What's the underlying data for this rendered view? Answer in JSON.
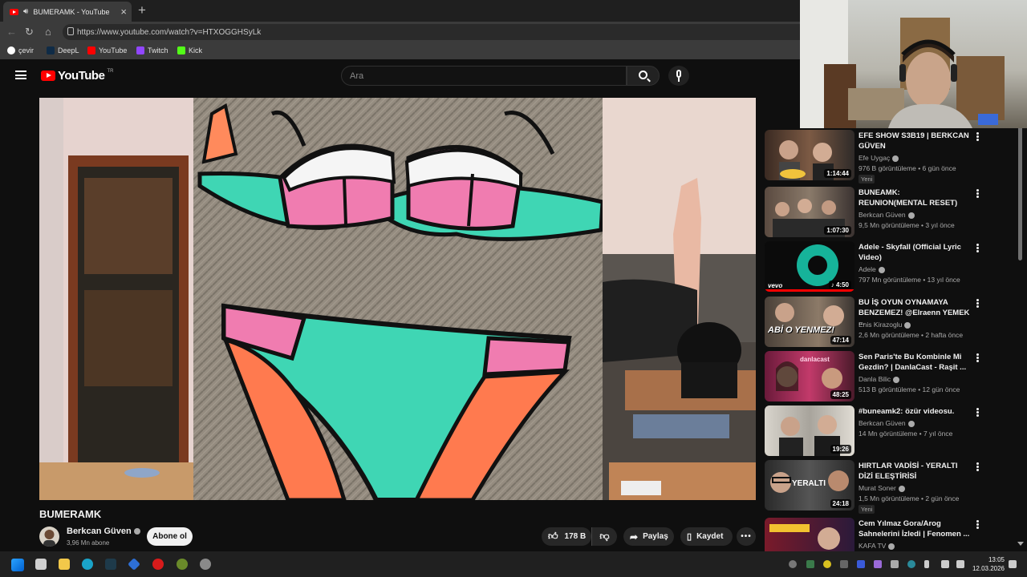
{
  "browser": {
    "tab_title": "BUMERAMK - YouTube",
    "url": "https://www.youtube.com/watch?v=HTXOGGHSyLk",
    "bookmarks": [
      "çevir",
      "DeepL",
      "YouTube",
      "Twitch",
      "Kick"
    ]
  },
  "header": {
    "logo_text": "YouTube",
    "region": "TR",
    "search_placeholder": "Ara"
  },
  "video": {
    "title": "BUMERAMK",
    "channel": "Berkcan Güven",
    "subscribers": "3,96 Mn abone",
    "subscribe_label": "Abone ol",
    "likes": "178 B",
    "share_label": "Paylaş",
    "save_label": "Kaydet"
  },
  "recommendations": [
    {
      "title": "EFE SHOW S3B19 | BERKCAN GÜVEN",
      "channel": "Efe Uygaç",
      "views": "976 B görüntüleme",
      "age": "6 gün önce",
      "duration": "1:14:44",
      "new": "Yeni"
    },
    {
      "title": "BUNEAMK: REUNION(MENTAL RESET)",
      "channel": "Berkcan Güven",
      "views": "9,5 Mn görüntüleme",
      "age": "3 yıl önce",
      "duration": "1:07:30"
    },
    {
      "title": "Adele - Skyfall (Official Lyric Video)",
      "channel": "Adele",
      "views": "797 Mn görüntüleme",
      "age": "13 yıl önce",
      "duration": "4:50",
      "badge": "vevo"
    },
    {
      "title": "BU İŞ OYUN OYNAMAYA BENZEMEZ! @Elraenn YEMEK ...",
      "channel": "Enis Kirazoglu",
      "views": "2,6 Mn görüntüleme",
      "age": "2 hafta önce",
      "duration": "47:14",
      "thumb_text": "ABİ O YENMEZ!"
    },
    {
      "title": "Sen Paris'te Bu Kombinle Mi Gezdin? | DanlaCast - Raşit ...",
      "channel": "Danla Bilic",
      "views": "513 B görüntüleme",
      "age": "12 gün önce",
      "duration": "48:25",
      "thumb_text": "danlacast"
    },
    {
      "title": "#buneamk2: özür videosu.",
      "channel": "Berkcan Güven",
      "views": "14 Mn görüntüleme",
      "age": "7 yıl önce",
      "duration": "19:26"
    },
    {
      "title": "HIRTLAR VADİSİ - YERALTI DİZİ ELEŞTİRİSİ",
      "channel": "Murat Soner",
      "views": "1,5 Mn görüntüleme",
      "age": "2 gün önce",
      "duration": "24:18",
      "new": "Yeni",
      "thumb_text": "YERALTI"
    },
    {
      "title": "Cem Yılmaz Gora/Arog Sahnelerini İzledi | Fenomen ...",
      "channel": "KAFA TV",
      "views": "",
      "age": "",
      "duration": ""
    }
  ],
  "taskbar": {
    "time": "13:05",
    "date": "12.03.2026"
  }
}
